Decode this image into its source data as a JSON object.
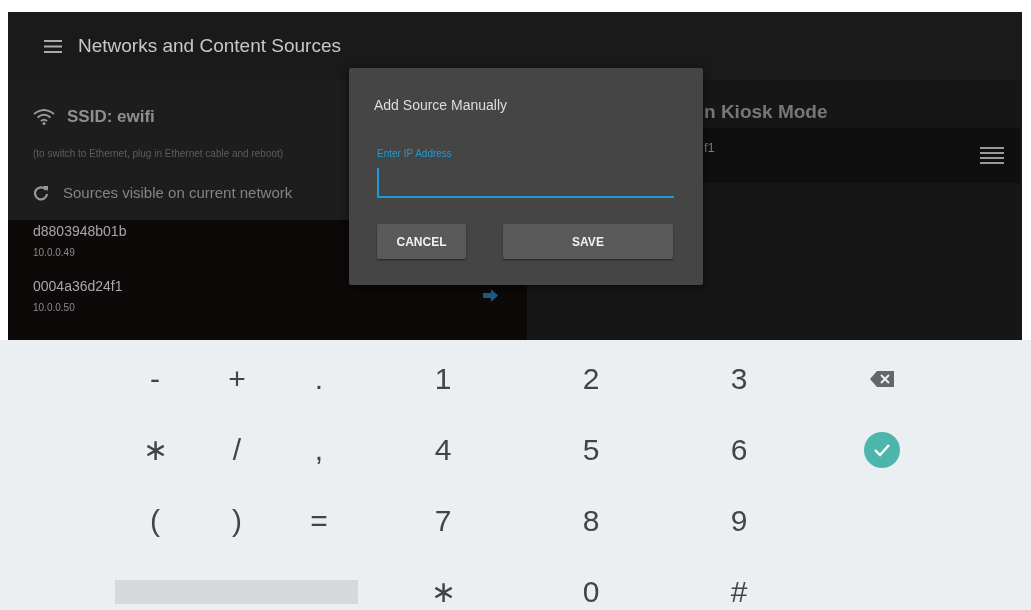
{
  "app_bar": {
    "title": "Networks and Content Sources"
  },
  "network": {
    "ssid": "SSID: ewifi",
    "hint": "(to switch to Ethernet, plug in Ethernet cable and reboot)",
    "sources_heading": "Sources visible on current network"
  },
  "sources": [
    {
      "name": "d8803948b01b",
      "ip": "10.0.0.49"
    },
    {
      "name": "0004a36d24f1",
      "ip": "10.0.0.50",
      "arrow": true
    }
  ],
  "kiosk": {
    "title": "n Kiosk Mode",
    "items": [
      {
        "text": "f1"
      }
    ]
  },
  "dialog": {
    "title": "Add Source Manually",
    "field": {
      "label": "Enter IP Address",
      "focused": true
    },
    "buttons": [
      {
        "label": "CANCEL"
      },
      {
        "label": "SAVE"
      }
    ]
  },
  "keyboard": {
    "rows": [
      [
        {
          "kind": "char",
          "label": "-"
        },
        {
          "kind": "char",
          "label": "+"
        },
        {
          "kind": "char",
          "label": "."
        },
        {
          "kind": "char",
          "label": "1"
        },
        {
          "kind": "char",
          "label": "2"
        },
        {
          "kind": "char",
          "label": "3"
        },
        {
          "kind": "backspace"
        }
      ],
      [
        {
          "kind": "char",
          "label": "∗"
        },
        {
          "kind": "char",
          "label": "/"
        },
        {
          "kind": "char",
          "label": ","
        },
        {
          "kind": "char",
          "label": "4"
        },
        {
          "kind": "char",
          "label": "5"
        },
        {
          "kind": "char",
          "label": "6"
        },
        {
          "kind": "enter"
        }
      ],
      [
        {
          "kind": "char",
          "label": "("
        },
        {
          "kind": "char",
          "label": ")"
        },
        {
          "kind": "char",
          "label": "="
        },
        {
          "kind": "char",
          "label": "7"
        },
        {
          "kind": "char",
          "label": "8"
        },
        {
          "kind": "char",
          "label": "9"
        },
        {
          "kind": "empty"
        }
      ],
      [
        {
          "kind": "space"
        },
        {
          "kind": "empty"
        },
        {
          "kind": "empty"
        },
        {
          "kind": "char",
          "label": "∗"
        },
        {
          "kind": "char",
          "label": "0"
        },
        {
          "kind": "char",
          "label": "#"
        }
      ]
    ]
  }
}
